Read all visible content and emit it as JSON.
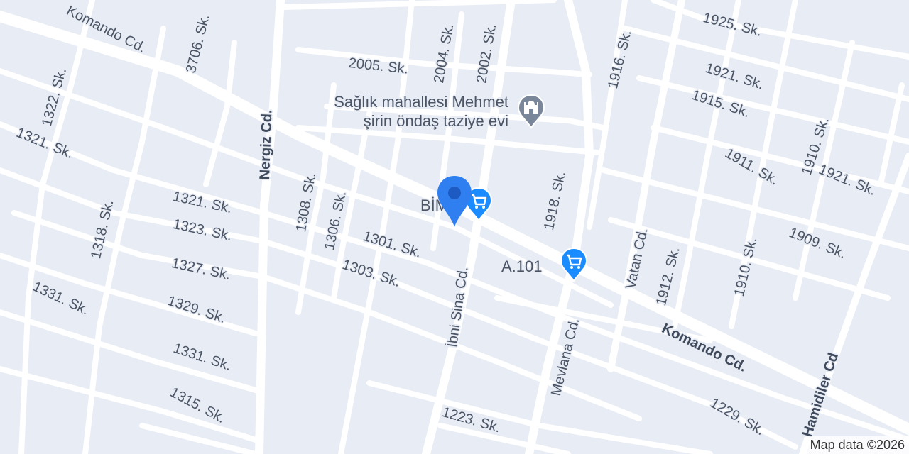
{
  "map": {
    "attribution": "Map data ©2026",
    "colors": {
      "background": "#e8ecf4",
      "road": "#ffffff",
      "label": "#4b5566",
      "shop_pin": "#1a8cff",
      "mosque_pin": "#7a8699",
      "location_pin": "#2f7ff0"
    },
    "street_labels": [
      {
        "id": "komando-cd-top",
        "text": "Komando Cd.",
        "major": false
      },
      {
        "id": "s3706",
        "text": "3706. Sk."
      },
      {
        "id": "s1322",
        "text": "1322. Sk."
      },
      {
        "id": "s1321a",
        "text": "1321. Sk."
      },
      {
        "id": "nergiz",
        "text": "Nergiz Cd.",
        "major": true
      },
      {
        "id": "s2005",
        "text": "2005. Sk."
      },
      {
        "id": "s2004",
        "text": "2004. Sk."
      },
      {
        "id": "s2002",
        "text": "2002. Sk."
      },
      {
        "id": "s1916",
        "text": "1916. Sk."
      },
      {
        "id": "s1925",
        "text": "1925. Sk."
      },
      {
        "id": "s1921a",
        "text": "1921. Sk."
      },
      {
        "id": "s1915",
        "text": "1915. Sk."
      },
      {
        "id": "s1910a",
        "text": "1910. Sk."
      },
      {
        "id": "s1911",
        "text": "1911. Sk."
      },
      {
        "id": "s1921b",
        "text": "1921. Sk."
      },
      {
        "id": "s1308",
        "text": "1308. Sk."
      },
      {
        "id": "s1306",
        "text": "1306. Sk."
      },
      {
        "id": "s1318",
        "text": "1318. Sk."
      },
      {
        "id": "s1321b",
        "text": "1321. Sk."
      },
      {
        "id": "s1323",
        "text": "1323. Sk."
      },
      {
        "id": "s1301",
        "text": "1301. Sk."
      },
      {
        "id": "s1918",
        "text": "1918. Sk."
      },
      {
        "id": "ibni",
        "text": "İbni Sina Cd."
      },
      {
        "id": "s1327",
        "text": "1327. Sk."
      },
      {
        "id": "s1303",
        "text": "1303. Sk."
      },
      {
        "id": "vatan",
        "text": "Vatan Cd."
      },
      {
        "id": "s1912",
        "text": "1912. Sk."
      },
      {
        "id": "s1910b",
        "text": "1910. Sk."
      },
      {
        "id": "s1909",
        "text": "1909. Sk."
      },
      {
        "id": "s1331a",
        "text": "1331. Sk."
      },
      {
        "id": "s1329",
        "text": "1329. Sk."
      },
      {
        "id": "mevlana",
        "text": "Mevlana Cd."
      },
      {
        "id": "komando-cd-bottom",
        "text": "Komando Cd.",
        "major": true
      },
      {
        "id": "s1331b",
        "text": "1331. Sk."
      },
      {
        "id": "hamidiler",
        "text": "Hamidiler Cd",
        "major": true
      },
      {
        "id": "s1315",
        "text": "1315. Sk."
      },
      {
        "id": "s1223",
        "text": "1223. Sk."
      },
      {
        "id": "s1229",
        "text": "1229. Sk."
      }
    ],
    "pois": {
      "mosque": {
        "name_line1": "Sağlık mahallesi Mehmet",
        "name_line2": "şirin öndaş taziye evi",
        "icon": "mosque-icon"
      },
      "bim": {
        "name": "BİM",
        "icon": "shopping-cart-icon"
      },
      "a101": {
        "name": "A.101",
        "icon": "shopping-cart-icon"
      },
      "location": {
        "icon": "location-pin-icon"
      }
    }
  }
}
